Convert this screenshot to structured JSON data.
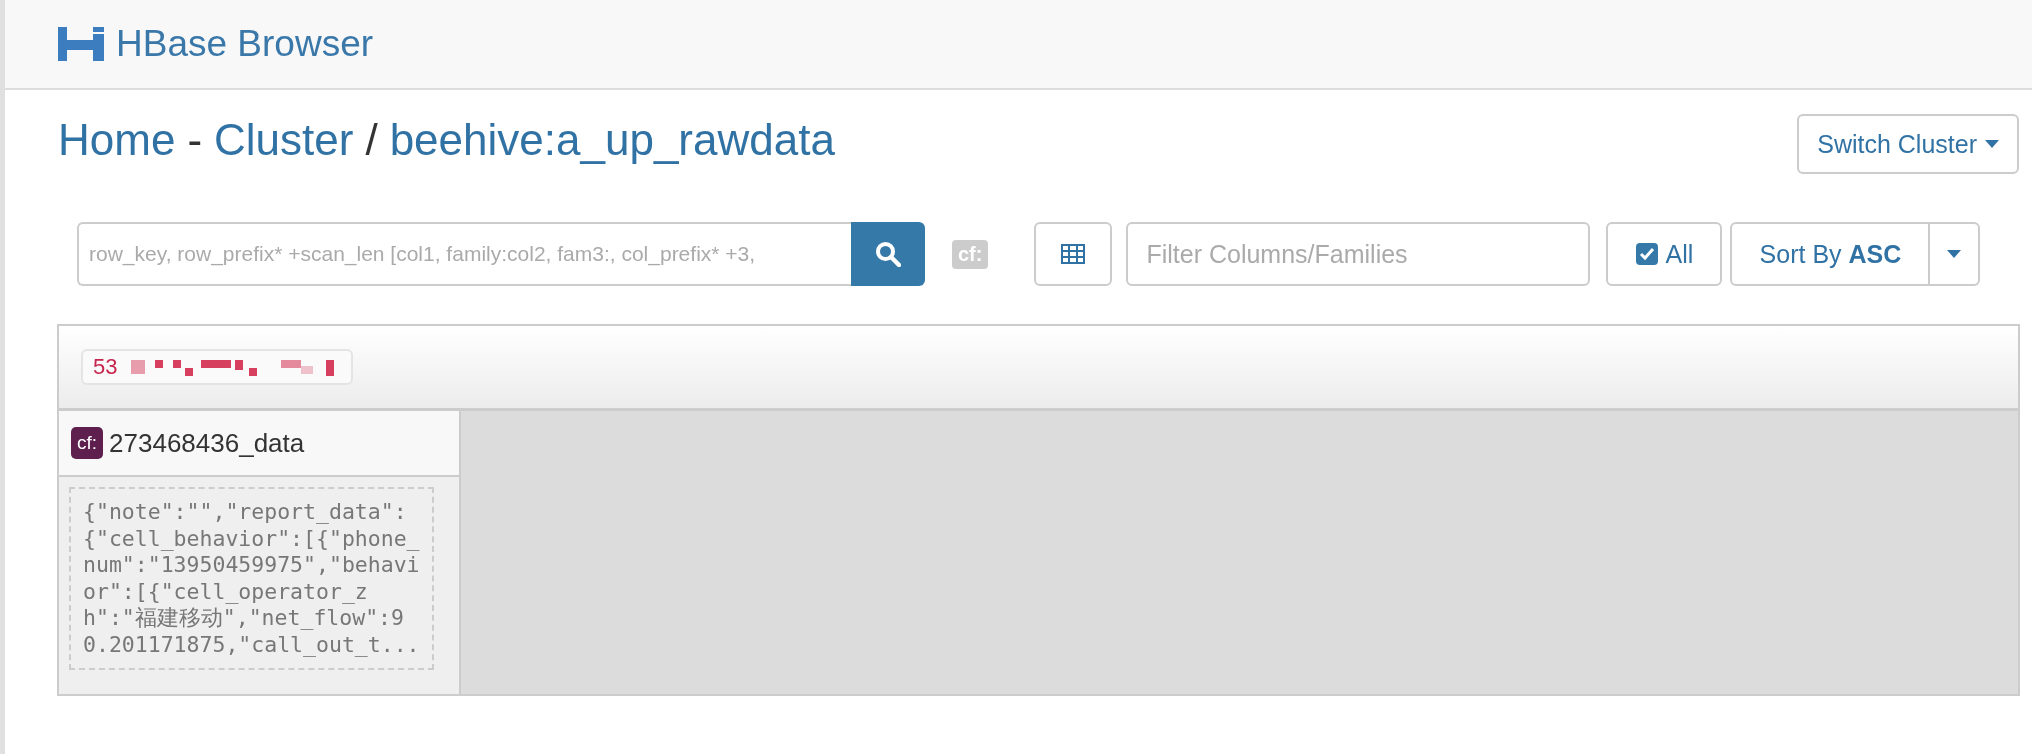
{
  "app": {
    "title": "HBase Browser"
  },
  "breadcrumb": [
    {
      "label": "Home",
      "kind": "link"
    },
    {
      "label": "-",
      "kind": "sep"
    },
    {
      "label": "Cluster",
      "kind": "link"
    },
    {
      "label": "/",
      "kind": "sep"
    },
    {
      "label": "beehive:a_up_rawdata",
      "kind": "link"
    }
  ],
  "switch_cluster": {
    "label": "Switch Cluster"
  },
  "search": {
    "placeholder": "row_key, row_prefix* +scan_len [col1, family:col2, fam3:, col_prefix* +3,"
  },
  "family_badge": "cf:",
  "filter": {
    "placeholder": "Filter Columns/Families"
  },
  "all_toggle": {
    "label": "All",
    "checked": true
  },
  "sort": {
    "prefix": "Sort By ",
    "order": "ASC"
  },
  "row": {
    "key": "53",
    "cells": [
      {
        "family": "cf:",
        "column": "273468436_data",
        "value": "{\"note\":\"\",\"report_data\":{\"cell_behavior\":[{\"phone_num\":\"13950459975\",\"behavior\":[{\"cell_operator_zh\":\"福建移动\",\"net_flow\":90.201171875,\"call_out_t..."
      }
    ]
  }
}
